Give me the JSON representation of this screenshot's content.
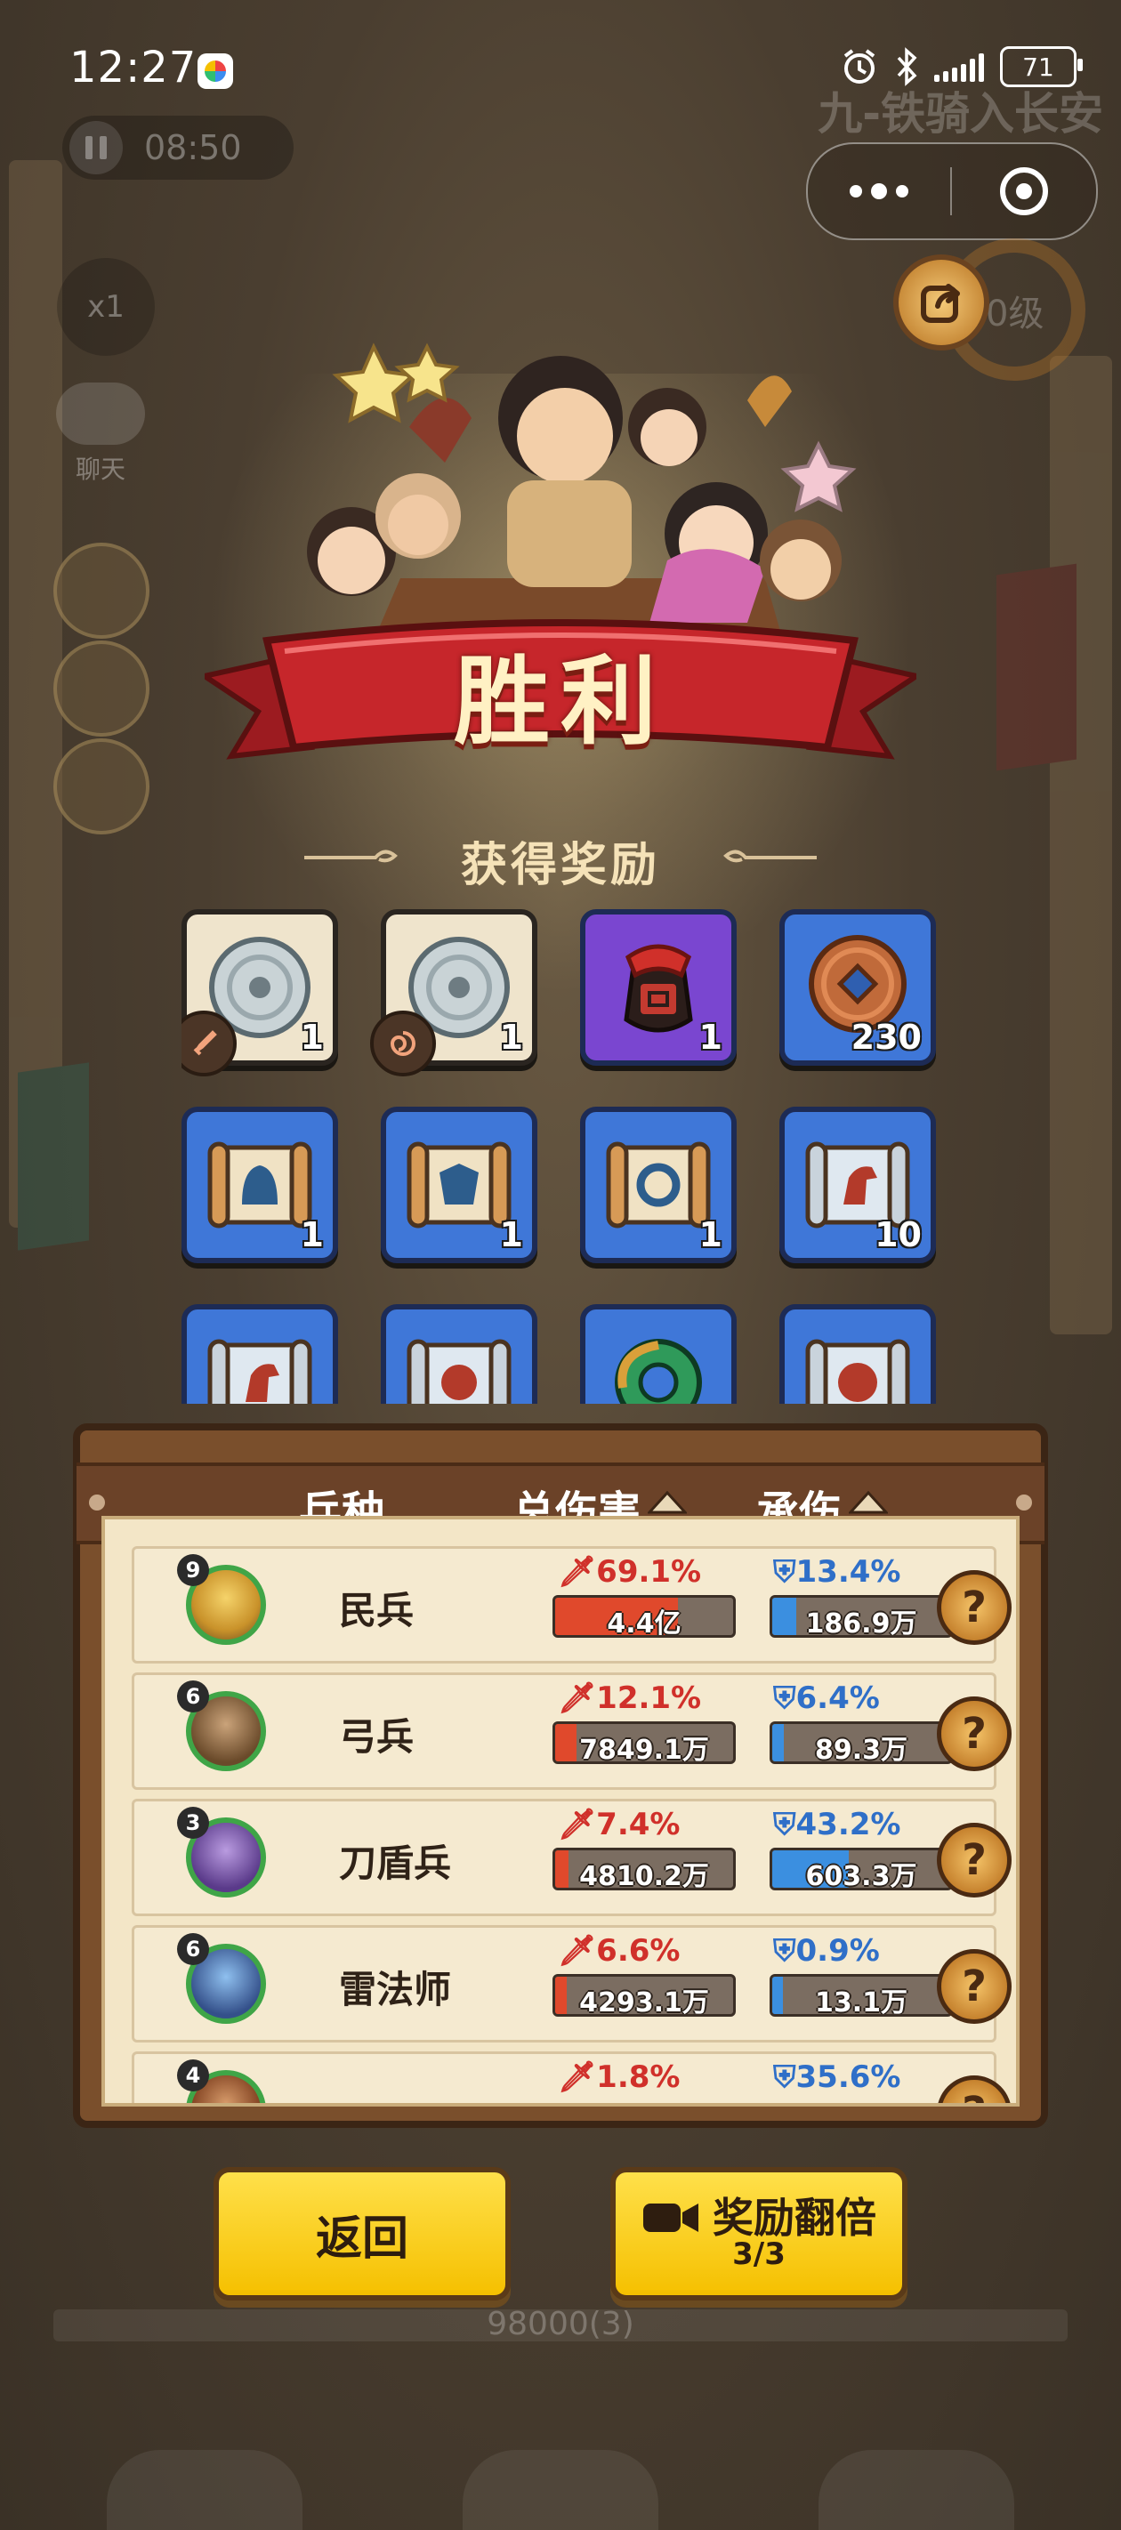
{
  "status_bar": {
    "time": "12:27",
    "battery": "71"
  },
  "hud": {
    "timer": "08:50",
    "speed": "x1",
    "chat_label": "聊天",
    "stage_title": "九-铁骑入长安",
    "level_label": "0级"
  },
  "victory": {
    "title": "胜利",
    "reward_header": "获得奖励"
  },
  "rewards": [
    {
      "name": "silver-disc",
      "count": "1",
      "style": "beige",
      "badge": "sword-icon"
    },
    {
      "name": "silver-disc",
      "count": "1",
      "style": "beige",
      "badge": "swirl-icon"
    },
    {
      "name": "red-jar",
      "count": "1",
      "style": "purple"
    },
    {
      "name": "copper-coin",
      "count": "230",
      "style": "blue"
    },
    {
      "name": "scroll-helmet",
      "count": "1",
      "style": "blue"
    },
    {
      "name": "scroll-armor",
      "count": "1",
      "style": "blue"
    },
    {
      "name": "scroll-ring",
      "count": "1",
      "style": "blue"
    },
    {
      "name": "scroll-horse",
      "count": "10",
      "style": "blue"
    },
    {
      "name": "scroll-horse-red",
      "count": "",
      "style": "blue"
    },
    {
      "name": "scroll-swirl",
      "count": "",
      "style": "blue"
    },
    {
      "name": "jade-ring",
      "count": "",
      "style": "blue"
    },
    {
      "name": "scroll-tiger",
      "count": "",
      "style": "blue"
    }
  ],
  "stats": {
    "headers": {
      "unit": "兵种",
      "damage": "总伤害",
      "taken": "承伤"
    },
    "rows": [
      {
        "level": "9",
        "name": "民兵",
        "dmg_pct": "69.1%",
        "dmg_val": "4.4亿",
        "dmg_ratio": 0.691,
        "def_pct": "13.4%",
        "def_val": "186.9万",
        "def_ratio": 0.134
      },
      {
        "level": "6",
        "name": "弓兵",
        "dmg_pct": "12.1%",
        "dmg_val": "7849.1万",
        "dmg_ratio": 0.121,
        "def_pct": "6.4%",
        "def_val": "89.3万",
        "def_ratio": 0.064
      },
      {
        "level": "3",
        "name": "刀盾兵",
        "dmg_pct": "7.4%",
        "dmg_val": "4810.2万",
        "dmg_ratio": 0.074,
        "def_pct": "43.2%",
        "def_val": "603.3万",
        "def_ratio": 0.432
      },
      {
        "level": "6",
        "name": "雷法师",
        "dmg_pct": "6.6%",
        "dmg_val": "4293.1万",
        "dmg_ratio": 0.066,
        "def_pct": "0.9%",
        "def_val": "13.1万",
        "def_ratio": 0.009
      },
      {
        "level": "4",
        "name": "",
        "dmg_pct": "1.8%",
        "dmg_val": "",
        "dmg_ratio": 0.018,
        "def_pct": "35.6%",
        "def_val": "",
        "def_ratio": 0.356
      }
    ]
  },
  "buttons": {
    "back": "返回",
    "double": "奖励翻倍",
    "double_count": "3/3"
  },
  "progress_text": "98000(3)",
  "colors": {
    "accent_yellow": "#f5c000",
    "damage_red": "#e0492c",
    "defense_blue": "#3b8fe0",
    "banner_red": "#c6262b"
  }
}
